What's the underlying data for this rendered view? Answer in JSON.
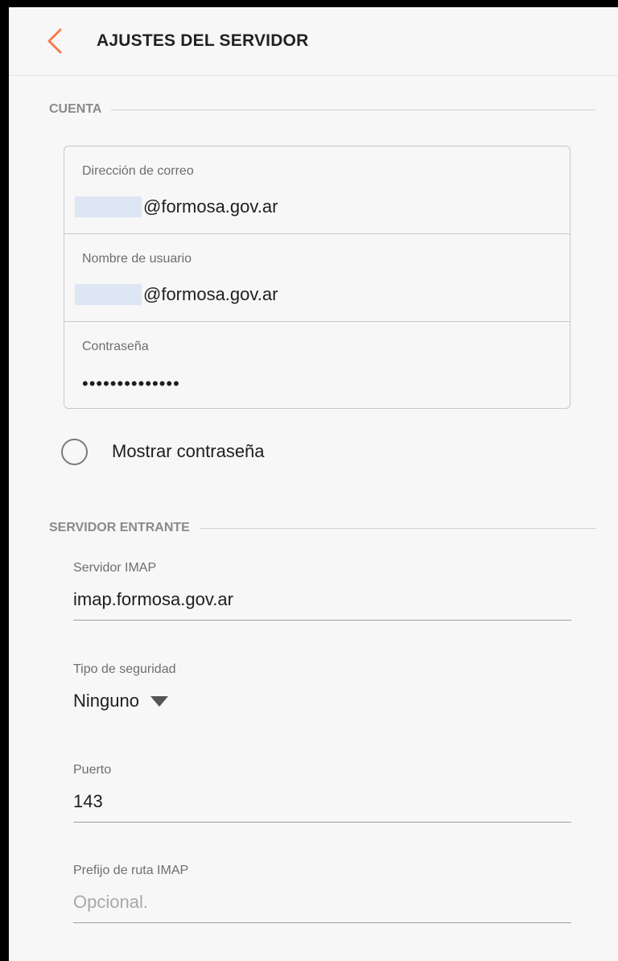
{
  "header": {
    "title": "AJUSTES DEL SERVIDOR",
    "back_icon": "chevron-left-icon",
    "accent_color": "#f47c4a"
  },
  "account_section": {
    "title": "CUENTA",
    "email": {
      "label": "Dirección de correo",
      "value": "@formosa.gov.ar"
    },
    "username": {
      "label": "Nombre de usuario",
      "value": "@formosa.gov.ar"
    },
    "password": {
      "label": "Contraseña",
      "value": "••••••••••••••"
    },
    "show_password": {
      "label": "Mostrar contraseña",
      "checked": false
    }
  },
  "incoming_section": {
    "title": "SERVIDOR ENTRANTE",
    "imap_server": {
      "label": "Servidor IMAP",
      "value": "imap.formosa.gov.ar"
    },
    "security_type": {
      "label": "Tipo de seguridad",
      "value": "Ninguno"
    },
    "port": {
      "label": "Puerto",
      "value": "143"
    },
    "imap_prefix": {
      "label": "Prefijo de ruta IMAP",
      "placeholder": "Opcional."
    }
  }
}
